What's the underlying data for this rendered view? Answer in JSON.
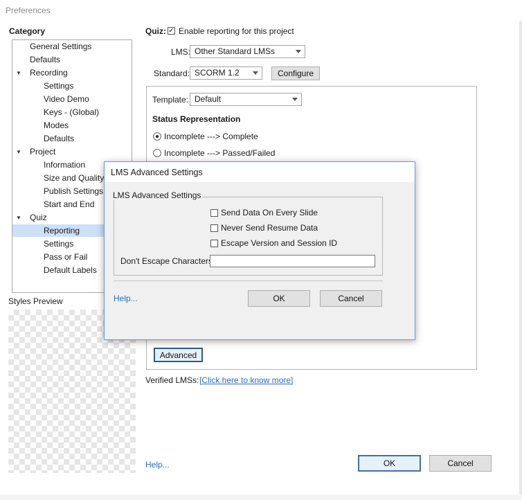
{
  "window": {
    "title": "Preferences"
  },
  "category": {
    "heading": "Category",
    "items": [
      {
        "label": "General Settings"
      },
      {
        "label": "Defaults"
      },
      {
        "label": "Recording"
      },
      {
        "label": "Settings"
      },
      {
        "label": "Video Demo"
      },
      {
        "label": "Keys - (Global)"
      },
      {
        "label": "Modes"
      },
      {
        "label": "Defaults"
      },
      {
        "label": "Project"
      },
      {
        "label": "Information"
      },
      {
        "label": "Size and Quality"
      },
      {
        "label": "Publish Settings"
      },
      {
        "label": "Start and End"
      },
      {
        "label": "Quiz"
      },
      {
        "label": "Reporting"
      },
      {
        "label": "Settings"
      },
      {
        "label": "Pass or Fail"
      },
      {
        "label": "Default Labels"
      }
    ],
    "selected": "Reporting",
    "expand_arrow": "▼"
  },
  "styles_preview": {
    "label": "Styles Preview"
  },
  "reporting": {
    "quiz_label": "Quiz:",
    "enable_checkbox": {
      "label": "Enable reporting for this project",
      "checked": true,
      "mark": "✓"
    },
    "lms_label": "LMS:",
    "lms_value": "Other Standard LMSs",
    "standard_label": "Standard:",
    "standard_value": "SCORM 1.2",
    "configure_button": "Configure",
    "template_label": "Template:",
    "template_value": "Default",
    "status_heading": "Status Representation",
    "status_options": [
      {
        "label": "Incomplete ---> Complete",
        "selected": true
      },
      {
        "label": "Incomplete ---> Passed/Failed",
        "selected": false
      }
    ],
    "advanced_button": "Advanced",
    "verified_label": "Verified LMSs:",
    "verified_link": "[Click here to know more]",
    "help_link": "Help...",
    "ok_button": "OK",
    "cancel_button": "Cancel"
  },
  "lms_dialog": {
    "title": "LMS Advanced Settings",
    "group_label": "LMS Advanced Settings",
    "options": [
      {
        "label": "Send Data On Every Slide",
        "checked": false
      },
      {
        "label": "Never Send Resume Data",
        "checked": false
      },
      {
        "label": "Escape Version and Session ID",
        "checked": false
      }
    ],
    "escape_label": "Don't Escape Characters:",
    "escape_value": "",
    "help_link": "Help...",
    "ok_button": "OK",
    "cancel_button": "Cancel"
  },
  "colors": {
    "selection": "#cce0f7",
    "link": "#2a6ebb",
    "dialog_border": "#6b9bd1",
    "default_button_border": "#3f6fa8"
  }
}
